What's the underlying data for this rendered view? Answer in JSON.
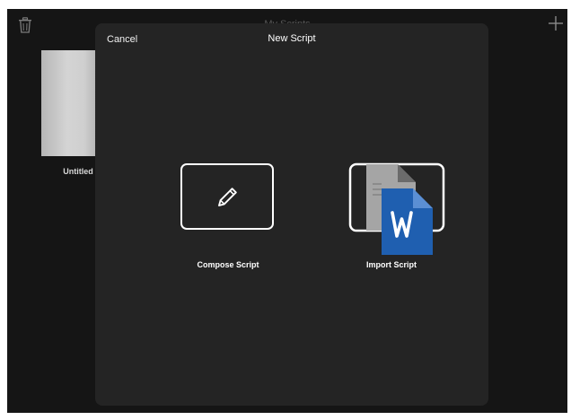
{
  "background": {
    "title": "My Scripts",
    "documents": [
      {
        "label": "Untitled"
      }
    ]
  },
  "icons": {
    "trash": "trash-icon",
    "add": "plus-icon",
    "compose": "pencil-icon",
    "import": "word-document-icon"
  },
  "modal": {
    "cancel_label": "Cancel",
    "title": "New Script",
    "options": [
      {
        "label": "Compose Script"
      },
      {
        "label": "Import Script"
      }
    ]
  },
  "colors": {
    "background": "#151515",
    "modal": "#242424",
    "word_blue": "#1f5fb0",
    "text": "#ffffff"
  }
}
